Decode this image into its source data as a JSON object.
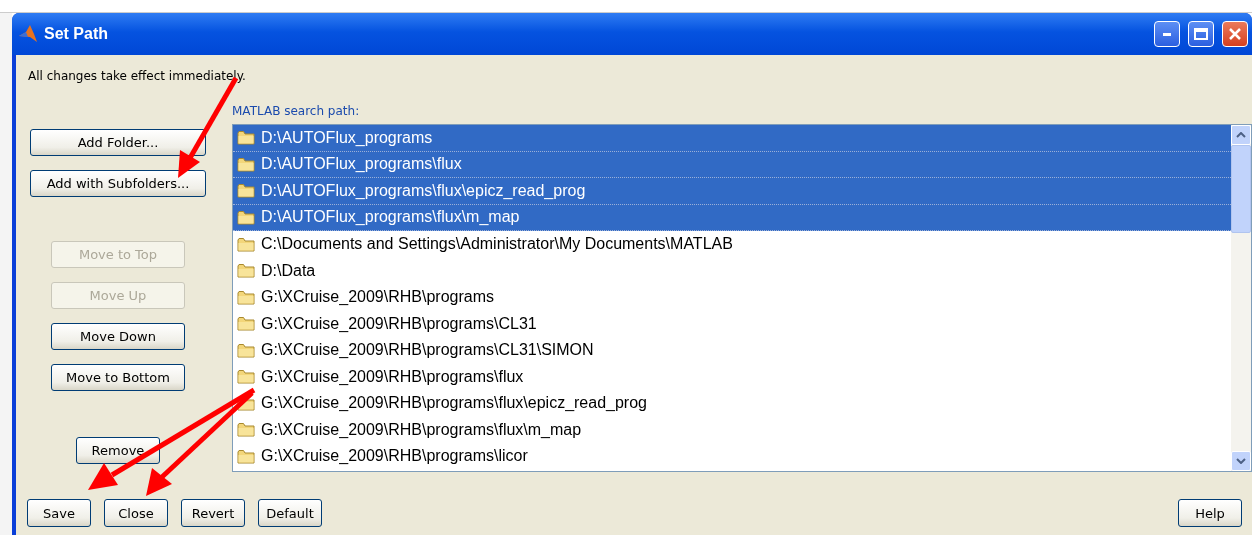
{
  "window": {
    "title": "Set Path"
  },
  "notice": "All changes take effect immediately.",
  "add_buttons": [
    {
      "label": "Add Folder...",
      "disabled": false
    },
    {
      "label": "Add with Subfolders...",
      "disabled": false
    }
  ],
  "move_buttons": [
    {
      "label": "Move to Top",
      "disabled": true
    },
    {
      "label": "Move Up",
      "disabled": true
    },
    {
      "label": "Move Down",
      "disabled": false
    },
    {
      "label": "Move to Bottom",
      "disabled": false
    }
  ],
  "remove_buttons": [
    {
      "label": "Remove",
      "disabled": false
    }
  ],
  "path_list": {
    "label": "MATLAB search path:",
    "rows": [
      {
        "path": "D:\\AUTOFlux_programs",
        "selected": true
      },
      {
        "path": "D:\\AUTOFlux_programs\\flux",
        "selected": true
      },
      {
        "path": "D:\\AUTOFlux_programs\\flux\\epicz_read_prog",
        "selected": true
      },
      {
        "path": "D:\\AUTOFlux_programs\\flux\\m_map",
        "selected": true
      },
      {
        "path": "C:\\Documents and Settings\\Administrator\\My Documents\\MATLAB",
        "selected": false
      },
      {
        "path": "D:\\Data",
        "selected": false
      },
      {
        "path": "G:\\XCruise_2009\\RHB\\programs",
        "selected": false
      },
      {
        "path": "G:\\XCruise_2009\\RHB\\programs\\CL31",
        "selected": false
      },
      {
        "path": "G:\\XCruise_2009\\RHB\\programs\\CL31\\SIMON",
        "selected": false
      },
      {
        "path": "G:\\XCruise_2009\\RHB\\programs\\flux",
        "selected": false
      },
      {
        "path": "G:\\XCruise_2009\\RHB\\programs\\flux\\epicz_read_prog",
        "selected": false
      },
      {
        "path": "G:\\XCruise_2009\\RHB\\programs\\flux\\m_map",
        "selected": false
      },
      {
        "path": "G:\\XCruise_2009\\RHB\\programs\\licor",
        "selected": false
      }
    ]
  },
  "bottom_buttons": [
    "Save",
    "Close",
    "Revert",
    "Default"
  ],
  "help_button": "Help"
}
